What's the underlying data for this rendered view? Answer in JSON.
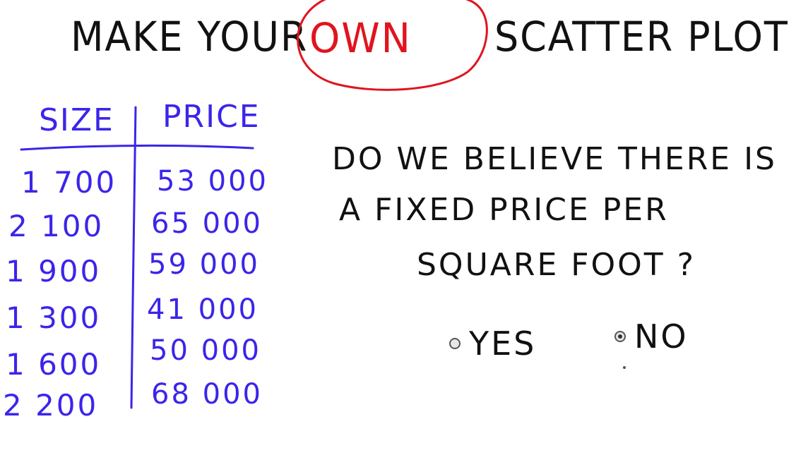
{
  "title": {
    "pre": "MAKE YOUR",
    "emphasis": "OWN",
    "post": "SCATTER PLOT !"
  },
  "table": {
    "headers": [
      "SIZE",
      "PRICE"
    ],
    "rows": [
      {
        "size": "1 700",
        "price": "53 000"
      },
      {
        "size": "2 100",
        "price": "65 000"
      },
      {
        "size": "1 900",
        "price": "59 000"
      },
      {
        "size": "1 300",
        "price": "41 000"
      },
      {
        "size": "1 600",
        "price": "50 000"
      },
      {
        "size": "2 200",
        "price": "68 000"
      }
    ]
  },
  "question": {
    "lines": [
      "DO WE BELIEVE THERE IS",
      "A FIXED PRICE PER",
      "SQUARE FOOT ?"
    ]
  },
  "options": {
    "yes": {
      "label": "YES",
      "selected": false
    },
    "no": {
      "label": "NO",
      "selected": true
    }
  },
  "colors": {
    "ink": "#111111",
    "table_ink": "#3b25ea",
    "highlight": "#e0141e",
    "background": "#ffffff"
  }
}
